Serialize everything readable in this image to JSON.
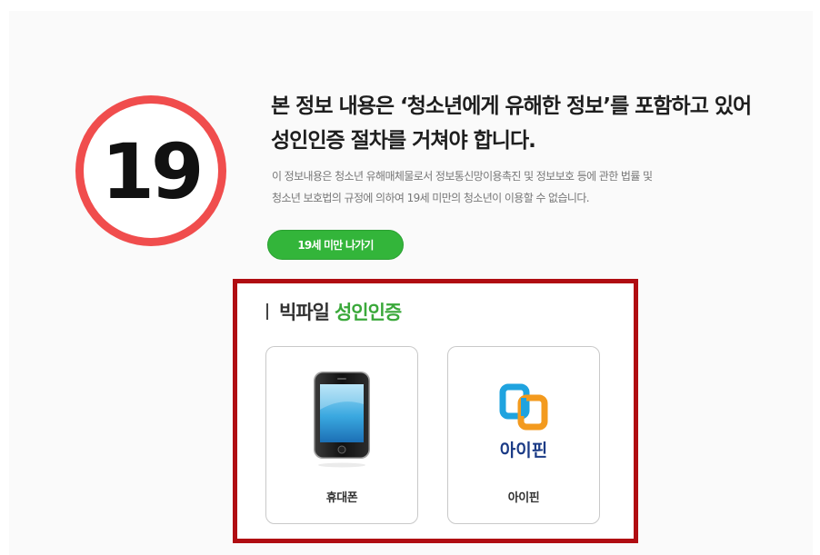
{
  "badge": {
    "age": "19"
  },
  "notice": {
    "headline_line1": "본 정보 내용은 ‘청소년에게 유해한 정보’를 포함하고 있어",
    "headline_line2": "성인인증 절차를 거쳐야 합니다.",
    "desc_line1": "이 정보내용은 청소년 유해매체물로서 정보통신망이용촉진 및 정보보호 등에 관한 법률 및",
    "desc_line2": "청소년 보호법의 규정에 의하여 19세 미만의 청소년이 이용할 수 없습니다."
  },
  "exit_button": {
    "label": "19세 미만 나가기"
  },
  "auth": {
    "title_main": "빅파일",
    "title_accent": "성인인증",
    "options": [
      {
        "label": "휴대폰",
        "icon": "mobile-phone-icon"
      },
      {
        "label": "아이핀",
        "icon": "ipin-logo",
        "logo_text": "아이핀"
      }
    ]
  },
  "colors": {
    "badge_ring": "#f04d4d",
    "exit_button_bg": "#33b53a",
    "auth_border": "#b00d12",
    "auth_accent": "#3aa83a"
  }
}
